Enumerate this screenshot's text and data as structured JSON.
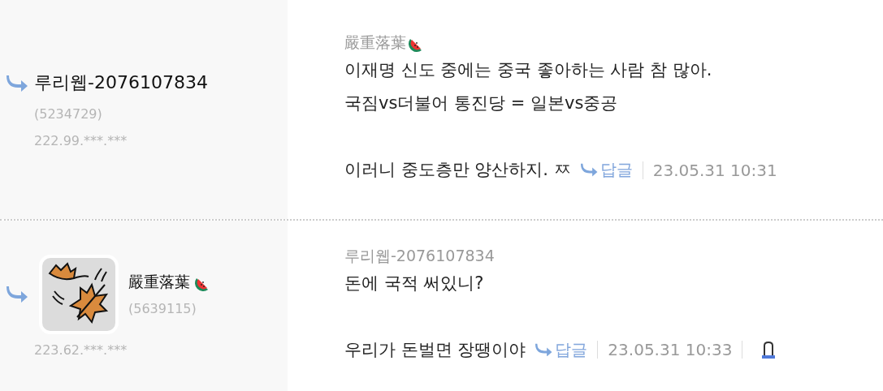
{
  "comments": [
    {
      "author": {
        "name": "루리웹-2076107834",
        "badge": false
      },
      "user_id": "(5234729)",
      "ip": "222.99.***.***",
      "avatar": false,
      "mention": {
        "name": "嚴重落葉",
        "badge": true
      },
      "paragraphs": [
        [
          "이재명 신도 중에는 중국 좋아하는 사람 참 많아.",
          "국짐vs더불어 통진당 = 일본vs중공"
        ],
        [
          "이러니 중도층만 양산하지. ㅉ"
        ]
      ],
      "reply_label": "답글",
      "date": "23.05.31 10:31",
      "report": false
    },
    {
      "author": {
        "name": "嚴重落葉",
        "badge": true
      },
      "user_id": "(5639115)",
      "ip": "223.62.***.***",
      "avatar": true,
      "mention": {
        "name": "루리웹-2076107834",
        "badge": false
      },
      "paragraphs": [
        [
          "돈에 국적 써있니?"
        ],
        [
          "우리가 돈벌면 장땡이야"
        ]
      ],
      "reply_label": "답글",
      "date": "23.05.31 10:33",
      "report": true
    }
  ]
}
